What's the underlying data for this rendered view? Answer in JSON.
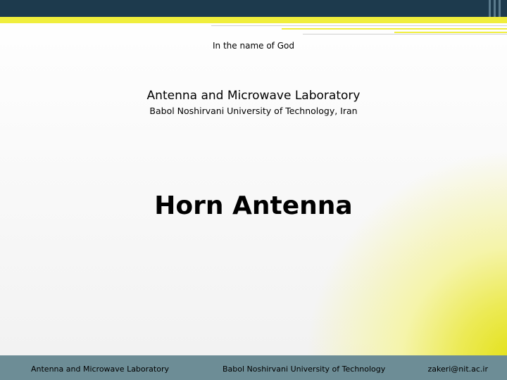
{
  "slide": {
    "header_text": "In the name of God",
    "lab_name": "Antenna and Microwave Laboratory",
    "university": "Babol Noshirvani University of Technology, Iran",
    "title": "Horn Antenna"
  },
  "footer": {
    "left": "Antenna and Microwave Laboratory",
    "center": "Babol Noshirvani University of Technology",
    "right": "zakeri@nit.ac.ir"
  },
  "colors": {
    "top_bar": "#1d3a4d",
    "accent_yellow": "#f0ee3c",
    "footer_bar": "#6d8d96"
  }
}
